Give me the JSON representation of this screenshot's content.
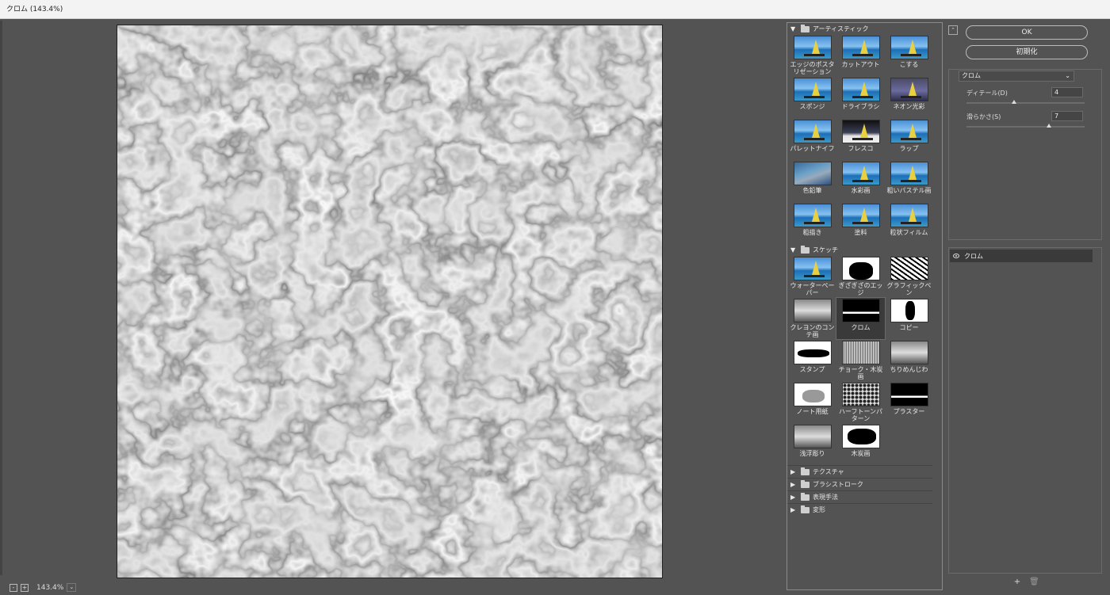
{
  "window": {
    "title": "クロム (143.4%)"
  },
  "status": {
    "zoom": "143.4%",
    "minus": "-",
    "plus": "+",
    "dropdown": "⌄"
  },
  "gallery": {
    "categories": [
      {
        "name": "アーティスティック",
        "expanded": true,
        "items": [
          "エッジのポスタリゼーション",
          "カットアウト",
          "こする",
          "スポンジ",
          "ドライブラシ",
          "ネオン光彩",
          "パレットナイフ",
          "フレスコ",
          "ラップ",
          "色鉛筆",
          "水彩画",
          "粗いパステル画",
          "粗描き",
          "塗料",
          "粒状フィルム"
        ]
      },
      {
        "name": "スケッチ",
        "expanded": true,
        "items": [
          "ウォーターペーパー",
          "ぎざぎざのエッジ",
          "グラフィックペン",
          "クレヨンのコンテ画",
          "クロム",
          "コピー",
          "スタンプ",
          "チョーク・木炭画",
          "ちりめんじわ",
          "ノート用紙",
          "ハーフトーンパターン",
          "プラスター",
          "浅浮彫り",
          "木炭画"
        ]
      },
      {
        "name": "テクスチャ",
        "expanded": false
      },
      {
        "name": "ブラシストローク",
        "expanded": false
      },
      {
        "name": "表現手法",
        "expanded": false
      },
      {
        "name": "変形",
        "expanded": false
      }
    ],
    "selected": "クロム"
  },
  "buttons": {
    "ok": "OK",
    "reset": "初期化"
  },
  "filter": {
    "selected": "クロム",
    "params": [
      {
        "label": "ディテール(D)",
        "value": "4",
        "level": 0.4
      },
      {
        "label": "滑らかさ(S)",
        "value": "7",
        "level": 0.7
      }
    ]
  },
  "layers": [
    {
      "name": "クロム",
      "visible": true
    }
  ],
  "icons": {
    "collapse": "⌃",
    "new_layer": "+",
    "delete": "🗑"
  }
}
